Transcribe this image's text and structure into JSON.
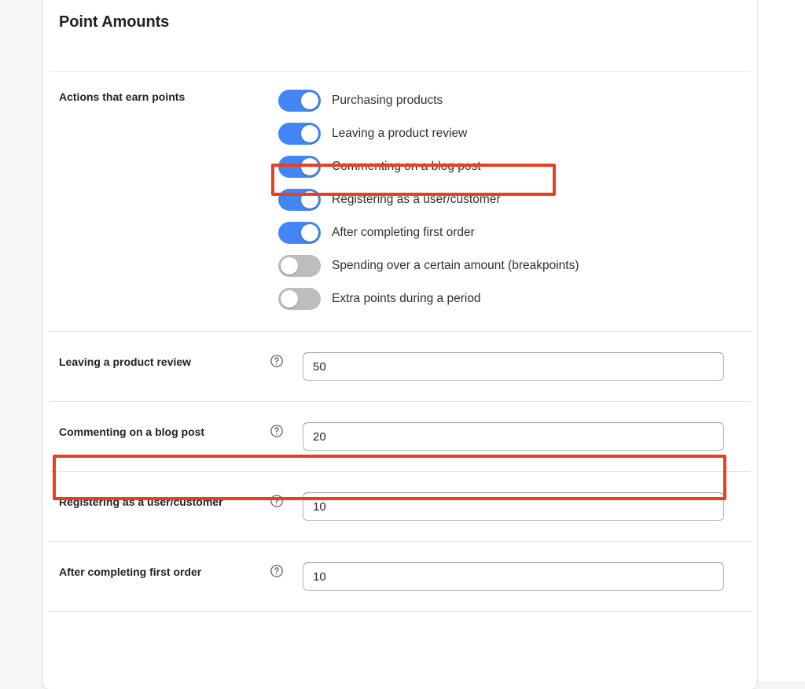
{
  "card": {
    "title": "Point Amounts"
  },
  "actions_section": {
    "label": "Actions that earn points",
    "toggles": [
      {
        "label": "Purchasing products",
        "on": true
      },
      {
        "label": "Leaving a product review",
        "on": true
      },
      {
        "label": "Commenting on a blog post",
        "on": true
      },
      {
        "label": "Registering as a user/customer",
        "on": true
      },
      {
        "label": "After completing first order",
        "on": true
      },
      {
        "label": "Spending over a certain amount (breakpoints)",
        "on": false
      },
      {
        "label": "Extra points during a period",
        "on": false
      }
    ]
  },
  "point_fields": [
    {
      "label": "Leaving a product review",
      "value": "50",
      "help_icon": "help-circle-icon"
    },
    {
      "label": "Commenting on a blog post",
      "value": "20",
      "help_icon": "help-circle-icon"
    },
    {
      "label": "Registering as a user/customer",
      "value": "10",
      "help_icon": "help-circle-icon"
    },
    {
      "label": "After completing first order",
      "value": "10",
      "help_icon": "help-circle-icon"
    }
  ],
  "highlights": [
    {
      "name": "commenting-toggle-highlight",
      "color": "#e8401f"
    },
    {
      "name": "commenting-points-field-highlight",
      "color": "#e8401f"
    }
  ],
  "colors": {
    "toggle_on": "#4285f4",
    "toggle_off": "#bdbdbd",
    "highlight": "#e8401f",
    "page_background": "#f6f6f7",
    "card_background": "#ffffff",
    "text": "#202223"
  }
}
